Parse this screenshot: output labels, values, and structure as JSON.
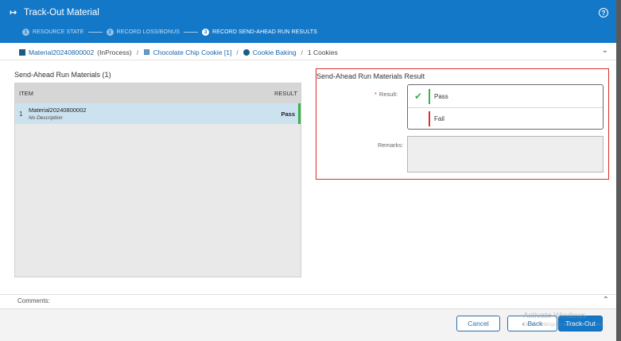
{
  "header": {
    "title": "Track-Out Material",
    "title_icon": "track-out-arrow-icon",
    "help_icon": "?"
  },
  "steps": [
    {
      "num": "1",
      "label": "RESOURCE STATE"
    },
    {
      "num": "2",
      "label": "RECORD LOSS/BONUS"
    },
    {
      "num": "3",
      "label": "RECORD SEND-AHEAD RUN RESULTS"
    }
  ],
  "breadcrumb": {
    "material": "Material20240800002",
    "state": "(InProcess)",
    "product": "Chocolate Chip Cookie [1]",
    "step": "Cookie Baking",
    "quantity": "1 Cookies",
    "sep": "/"
  },
  "left": {
    "title": "Send-Ahead Run Materials (1)",
    "columns": {
      "item": "ITEM",
      "result": "RESULT"
    },
    "rows": [
      {
        "index": "1",
        "name": "Material20240800002",
        "description": "No Description",
        "result": "Pass"
      }
    ]
  },
  "right": {
    "title": "Send-Ahead Run Materials Result",
    "result_label": "Result:",
    "required_mark": "*",
    "options": [
      {
        "label": "Pass",
        "color": "#3bb24a",
        "selected": true
      },
      {
        "label": "Fail",
        "color": "#d9302c",
        "selected": false
      }
    ],
    "remarks_label": "Remarks:",
    "remarks_value": ""
  },
  "comments_label": "Comments:",
  "footer": {
    "cancel": "Cancel",
    "back": "Back",
    "track_out": "Track-Out"
  },
  "watermark": {
    "title": "Activate Windows",
    "subtitle": "Go to Settings to activate Windows."
  },
  "colors": {
    "header_bg": "#1478c8",
    "selected_row": "#cde2ef",
    "pass": "#3bb24a",
    "fail": "#d9302c"
  }
}
